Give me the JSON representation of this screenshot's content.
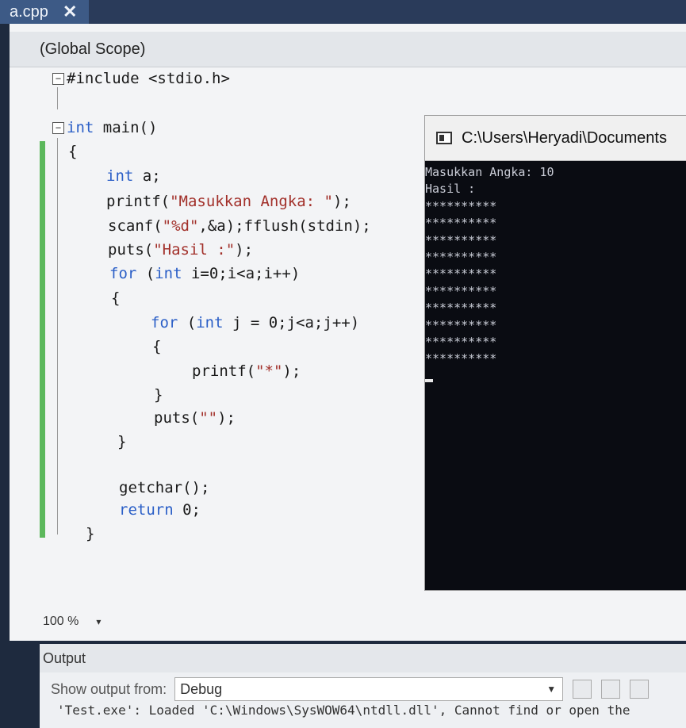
{
  "tab": {
    "label": "a.cpp",
    "close": "✕"
  },
  "scope": {
    "label": "(Global Scope)"
  },
  "code": {
    "l1": "#include <stdio.h>",
    "l2_kw": "int",
    "l2_rest": " main()",
    "l3": "{",
    "l4_kw": "int",
    "l4_rest": " a;",
    "l5_a": "printf(",
    "l5_str": "\"Masukkan Angka: \"",
    "l5_b": ");",
    "l6_a": "scanf(",
    "l6_str": "\"%d\"",
    "l6_b": ",&a);fflush(stdin);",
    "l7_a": "puts(",
    "l7_str": "\"Hasil :\"",
    "l7_b": ");",
    "l8_kw": "for",
    "l8_a": " (",
    "l8_kw2": "int",
    "l8_b": " i=0;i<a;i++)",
    "l9": "{",
    "l10_kw": "for",
    "l10_a": " (",
    "l10_kw2": "int",
    "l10_b": " j = 0;j<a;j++)",
    "l11": "{",
    "l12_a": "printf(",
    "l12_str": "\"*\"",
    "l12_b": ");",
    "l13": "}",
    "l14_a": "puts(",
    "l14_str": "\"\"",
    "l14_b": ");",
    "l15": "}",
    "l16": "getchar();",
    "l17_kw": "return",
    "l17_rest": " 0;",
    "l18": "}"
  },
  "zoom": {
    "label": "100 %"
  },
  "console": {
    "title": "C:\\Users\\Heryadi\\Documents",
    "lines": [
      "Masukkan Angka: 10",
      "Hasil :",
      "**********",
      "**********",
      "**********",
      "**********",
      "**********",
      "**********",
      "**********",
      "**********",
      "**********",
      "**********"
    ]
  },
  "output": {
    "header": "Output",
    "show_from_label": "Show output from:",
    "source": "Debug",
    "text": "'Test.exe': Loaded 'C:\\Windows\\SysWOW64\\ntdll.dll', Cannot find or open the"
  }
}
